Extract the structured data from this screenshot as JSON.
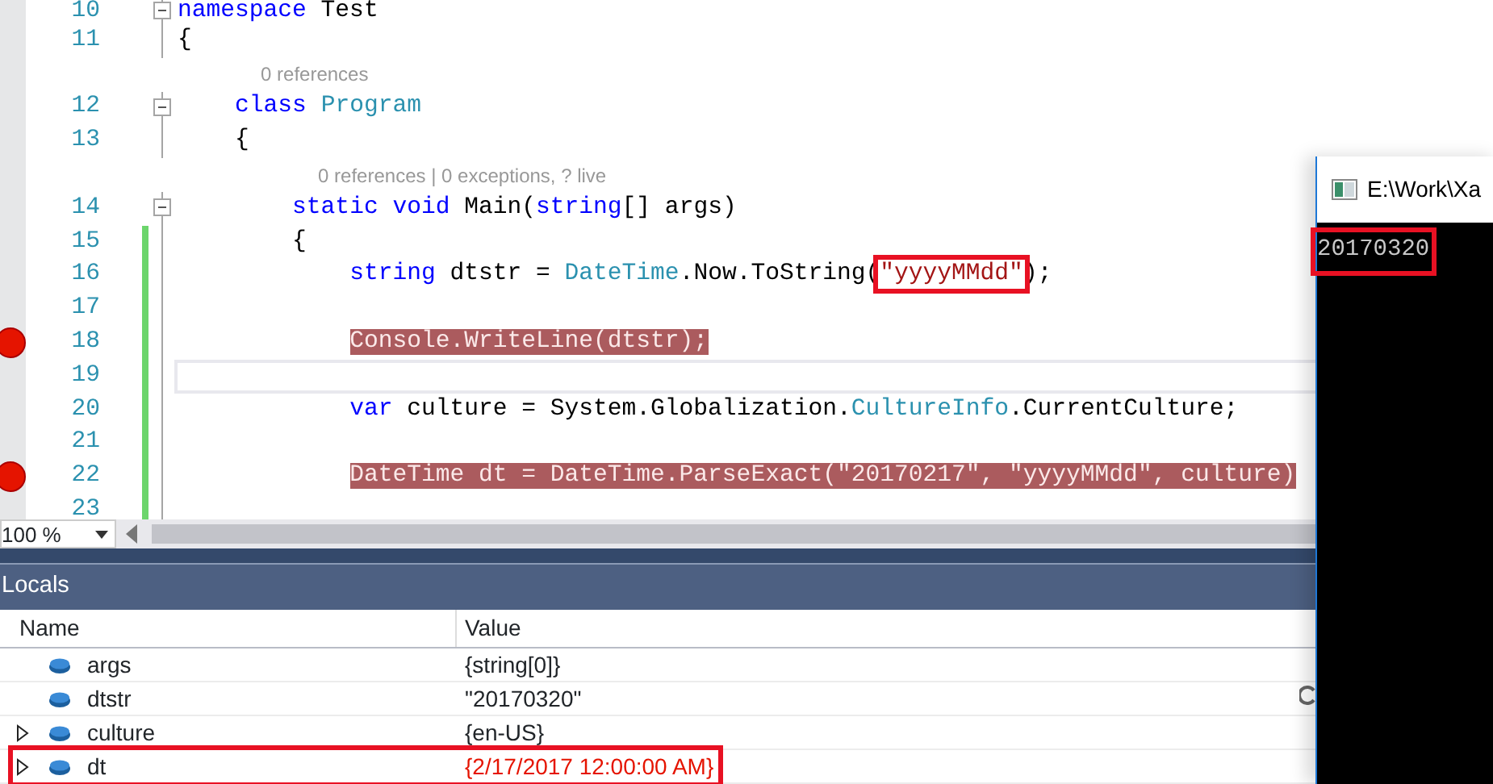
{
  "editor": {
    "lines": [
      {
        "kind": "code",
        "number": "10",
        "collapsible": true,
        "changed": false,
        "breakpoint": false,
        "current": false,
        "tokens": [
          {
            "kind": "keyword",
            "text": "namespace"
          },
          {
            "kind": "plain",
            "text": " Test"
          }
        ]
      },
      {
        "kind": "code",
        "number": "11",
        "collapsible": false,
        "changed": false,
        "breakpoint": false,
        "current": false,
        "tokens": [
          {
            "kind": "plain",
            "text": "{"
          }
        ]
      },
      {
        "kind": "codelens",
        "text": "    0 references"
      },
      {
        "kind": "code",
        "number": "12",
        "collapsible": true,
        "changed": false,
        "breakpoint": false,
        "current": false,
        "tokens": [
          {
            "kind": "keyword",
            "text": "    class"
          },
          {
            "kind": "type",
            "text": " Program"
          }
        ]
      },
      {
        "kind": "code",
        "number": "13",
        "collapsible": false,
        "changed": false,
        "breakpoint": false,
        "current": false,
        "tokens": [
          {
            "kind": "plain",
            "text": "    {"
          }
        ]
      },
      {
        "kind": "codelens",
        "text": "        0 references | 0 exceptions, ? live"
      },
      {
        "kind": "code",
        "number": "14",
        "collapsible": true,
        "changed": false,
        "breakpoint": false,
        "current": false,
        "tokens": [
          {
            "kind": "keyword",
            "text": "        static void"
          },
          {
            "kind": "plain",
            "text": " Main("
          },
          {
            "kind": "keyword",
            "text": "string"
          },
          {
            "kind": "plain",
            "text": "[] args)"
          }
        ]
      },
      {
        "kind": "code",
        "number": "15",
        "collapsible": false,
        "changed": true,
        "breakpoint": false,
        "current": false,
        "tokens": [
          {
            "kind": "plain",
            "text": "        {"
          }
        ]
      },
      {
        "kind": "code",
        "number": "16",
        "collapsible": false,
        "changed": true,
        "breakpoint": false,
        "current": false,
        "tokens": [
          {
            "kind": "keyword",
            "text": "            string"
          },
          {
            "kind": "plain",
            "text": " dtstr = "
          },
          {
            "kind": "type",
            "text": "DateTime"
          },
          {
            "kind": "plain",
            "text": ".Now.ToString("
          },
          {
            "kind": "string",
            "text": "\"yyyyMMdd\"",
            "highlighted": true
          },
          {
            "kind": "plain",
            "text": ");"
          }
        ]
      },
      {
        "kind": "code",
        "number": "17",
        "collapsible": false,
        "changed": true,
        "breakpoint": false,
        "current": false
      },
      {
        "kind": "code",
        "number": "18",
        "collapsible": false,
        "changed": true,
        "breakpoint": true,
        "current": false,
        "tokens": [
          {
            "text": "            Console.WriteLine(dtstr);"
          }
        ]
      },
      {
        "kind": "code",
        "number": "19",
        "collapsible": false,
        "changed": true,
        "breakpoint": false,
        "current": true
      },
      {
        "kind": "code",
        "number": "20",
        "collapsible": false,
        "changed": true,
        "breakpoint": false,
        "current": false,
        "tokens": [
          {
            "kind": "keyword",
            "text": "            var"
          },
          {
            "kind": "plain",
            "text": " culture = System.Globalization."
          },
          {
            "kind": "type",
            "text": "CultureInfo"
          },
          {
            "kind": "plain",
            "text": ".CurrentCulture;"
          }
        ]
      },
      {
        "kind": "code",
        "number": "21",
        "collapsible": false,
        "changed": true,
        "breakpoint": false,
        "current": false
      },
      {
        "kind": "code",
        "number": "22",
        "collapsible": false,
        "changed": true,
        "breakpoint": true,
        "current": false,
        "tokens": [
          {
            "text": "            DateTime dt = DateTime.ParseExact(\"20170217\", \"yyyyMMdd\", culture)"
          }
        ]
      },
      {
        "kind": "code",
        "number": "23",
        "collapsible": false,
        "changed": true,
        "breakpoint": false,
        "current": false
      }
    ]
  },
  "zoom": {
    "value": "100 %"
  },
  "locals": {
    "title": "Locals",
    "columns": [
      "Name",
      "Value"
    ],
    "rows": [
      {
        "name": "args",
        "value": "{string[0]}",
        "expandable": false,
        "error": false,
        "highlighted": false
      },
      {
        "name": "dtstr",
        "value": "\"20170320\"",
        "expandable": false,
        "error": false,
        "highlighted": false
      },
      {
        "name": "culture",
        "value": "{en-US}",
        "expandable": true,
        "error": false,
        "highlighted": false
      },
      {
        "name": "dt",
        "value": "{2/17/2017 12:00:00 AM}",
        "expandable": true,
        "error": true,
        "highlighted": true
      }
    ]
  },
  "console": {
    "title": "E:\\Work\\Xa",
    "output": "20170320",
    "output_highlighted": true
  }
}
